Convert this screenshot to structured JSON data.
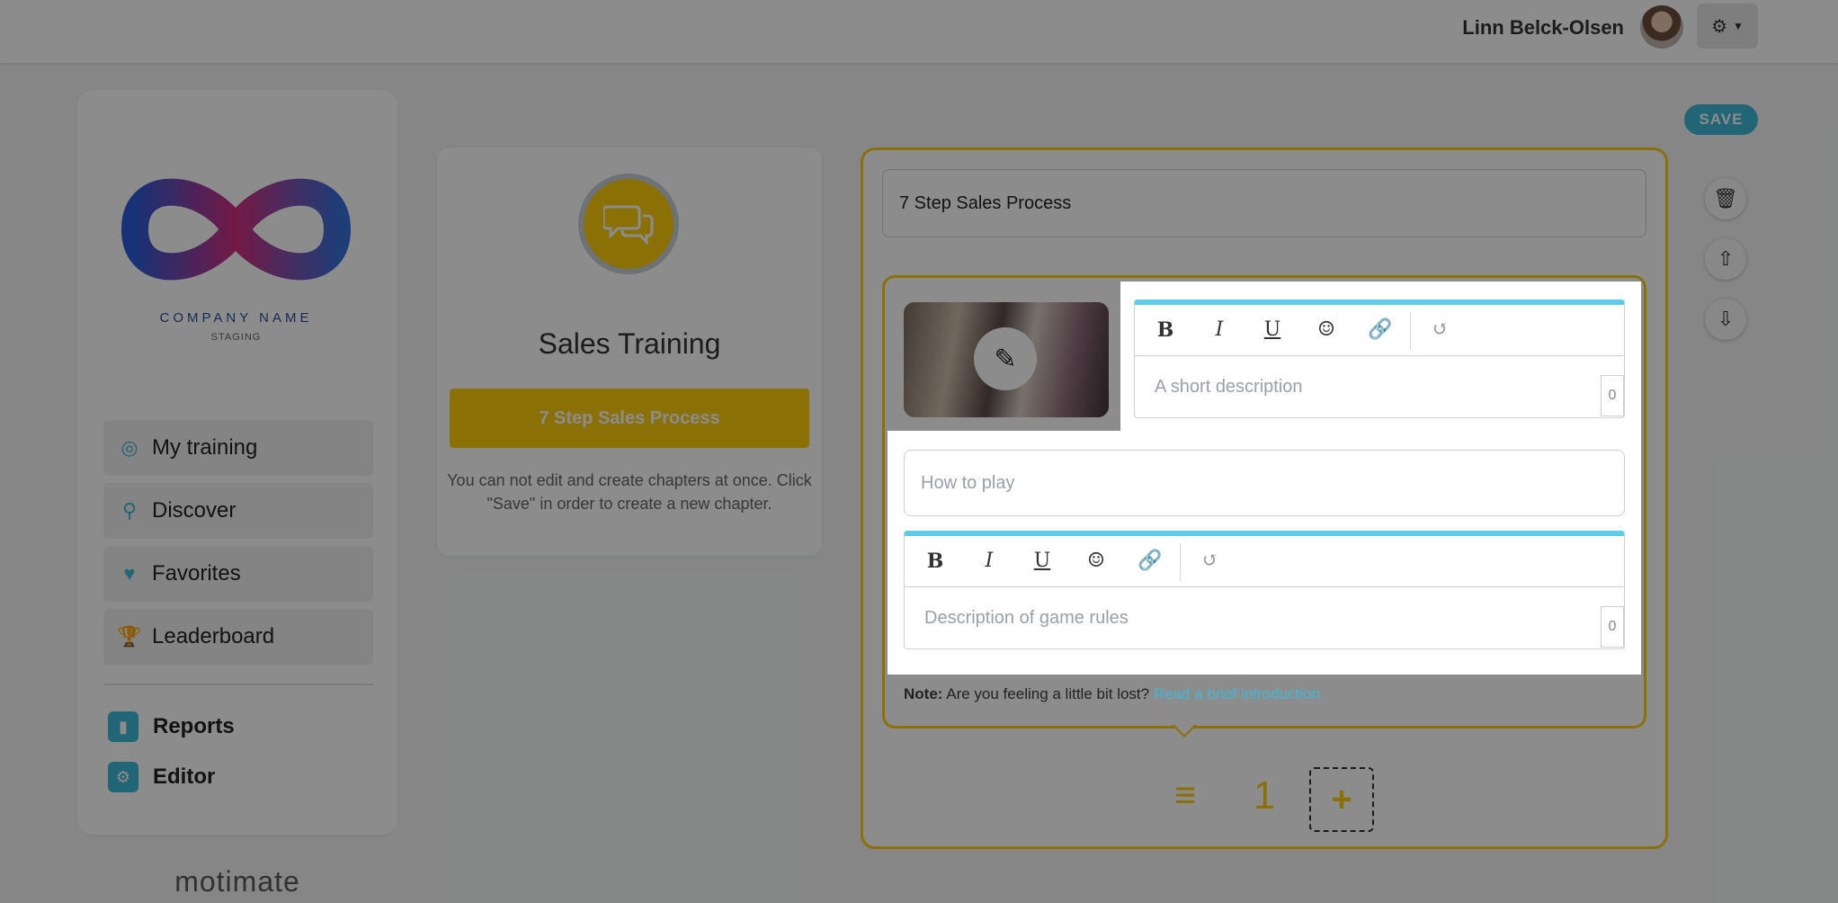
{
  "header": {
    "user_name": "Linn Belck-Olsen"
  },
  "sidebar": {
    "company_name": "COMPANY NAME",
    "company_tag": "STAGING",
    "items": [
      {
        "label": "My training",
        "icon": "target-icon"
      },
      {
        "label": "Discover",
        "icon": "search-icon"
      },
      {
        "label": "Favorites",
        "icon": "heart-icon"
      },
      {
        "label": "Leaderboard",
        "icon": "trophy-icon"
      }
    ],
    "links": [
      {
        "label": "Reports",
        "icon": "bar-chart-icon"
      },
      {
        "label": "Editor",
        "icon": "gear-icon"
      }
    ],
    "brand": "motimate"
  },
  "course": {
    "title": "Sales Training",
    "chapter_button": "7 Step Sales Process",
    "note": "You can not edit and create chapters at once. Click \"Save\" in order to create a new chapter."
  },
  "editor": {
    "save_label": "SAVE",
    "chapter_title": "7 Step Sales Process",
    "short_description_placeholder": "A short description",
    "short_description_count": "0",
    "how_to_play_placeholder": "How to play",
    "rules_placeholder": "Description of game rules",
    "rules_count": "0",
    "note_label": "Note:",
    "note_text": "Are you feeling a little bit lost?",
    "note_link": "Read a brief introduction.",
    "chapter_number": "1",
    "add_label": "+"
  },
  "colors": {
    "accent_yellow": "#fecc0b",
    "accent_blue": "#3fb8d8"
  }
}
